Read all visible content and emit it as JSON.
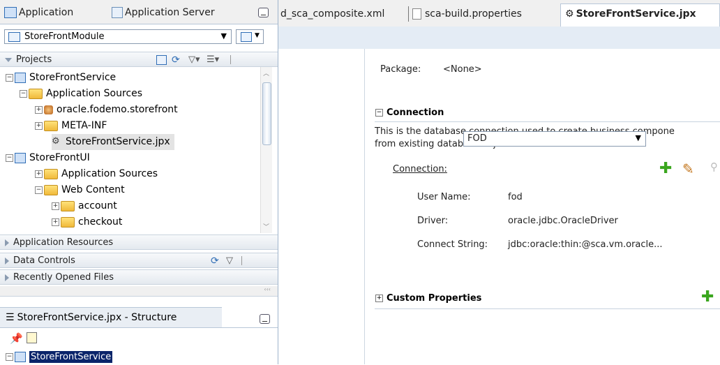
{
  "navigator": {
    "tabs": [
      {
        "label": "Application",
        "icon": "application-navigator-icon"
      },
      {
        "label": "Application Server",
        "icon": "application-server-icon"
      }
    ],
    "module": "StoreFrontModule",
    "projects_header": "Projects",
    "tree": [
      {
        "label": "StoreFrontService",
        "type": "project",
        "expander": "−"
      },
      {
        "label": "Application Sources",
        "type": "folder",
        "expander": "−"
      },
      {
        "label": "oracle.fodemo.storefront",
        "type": "package",
        "expander": "+"
      },
      {
        "label": "META-INF",
        "type": "folder",
        "expander": "+"
      },
      {
        "label": "StoreFrontService.jpx",
        "type": "jpx",
        "expander": ""
      },
      {
        "label": "StoreFrontUI",
        "type": "project",
        "expander": "−"
      },
      {
        "label": "Application Sources",
        "type": "folder",
        "expander": "+"
      },
      {
        "label": "Web Content",
        "type": "folder",
        "expander": "−"
      },
      {
        "label": "account",
        "type": "folder",
        "expander": "+"
      },
      {
        "label": "checkout",
        "type": "folder",
        "expander": "+"
      }
    ],
    "accordions": [
      "Application Resources",
      "Data Controls",
      "Recently Opened Files"
    ]
  },
  "structure": {
    "title": "StoreFrontService.jpx - Structure",
    "root": "StoreFrontService"
  },
  "editor": {
    "tabs": [
      {
        "label": "d_sca_composite.xml",
        "active": false
      },
      {
        "label": "sca-build.properties",
        "active": false
      },
      {
        "label": "StoreFrontService.jpx",
        "active": true
      }
    ],
    "package_label": "Package:",
    "package_value": "<None>",
    "connection_section": "Connection",
    "connection_desc_1": "This is the database connection used to create business compone",
    "connection_desc_2": "from existing database objects.",
    "connection_label": "Connection:",
    "connection_value": "FOD",
    "username_label": "User Name:",
    "username_value": "fod",
    "driver_label": "Driver:",
    "driver_value": "oracle.jdbc.OracleDriver",
    "connect_string_label": "Connect String:",
    "connect_string_value": "jdbc:oracle:thin:@sca.vm.oracle...",
    "custom_properties_section": "Custom Properties"
  },
  "colors": {
    "selected": "#0a246a",
    "accent_green": "#3aa61e",
    "band": "#e4ecf5"
  }
}
